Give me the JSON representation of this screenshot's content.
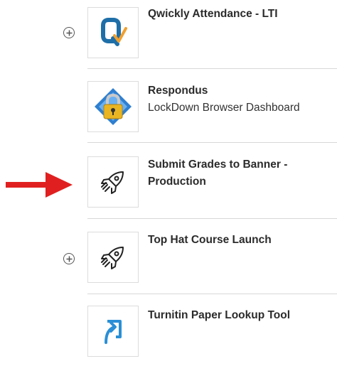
{
  "tools": [
    {
      "title": "Qwickly Attendance - LTI",
      "subtitle": "",
      "icon": "qwickly-logo-icon",
      "has_add": true
    },
    {
      "title": "Respondus",
      "subtitle": "LockDown Browser Dashboard",
      "icon": "respondus-lock-icon",
      "has_add": false
    },
    {
      "title": "Submit Grades to Banner - Production",
      "subtitle": "",
      "icon": "rocket-icon",
      "has_add": false,
      "highlighted": true
    },
    {
      "title": "Top Hat Course Launch",
      "subtitle": "",
      "icon": "rocket-icon",
      "has_add": true
    },
    {
      "title": "Turnitin Paper Lookup Tool",
      "subtitle": "",
      "icon": "turnitin-logo-icon",
      "has_add": false
    }
  ],
  "colors": {
    "arrow": "#e02020",
    "qwickly_blue": "#1e6fa8",
    "qwickly_check": "#f0a030",
    "turnitin_blue": "#2a8fd6"
  }
}
